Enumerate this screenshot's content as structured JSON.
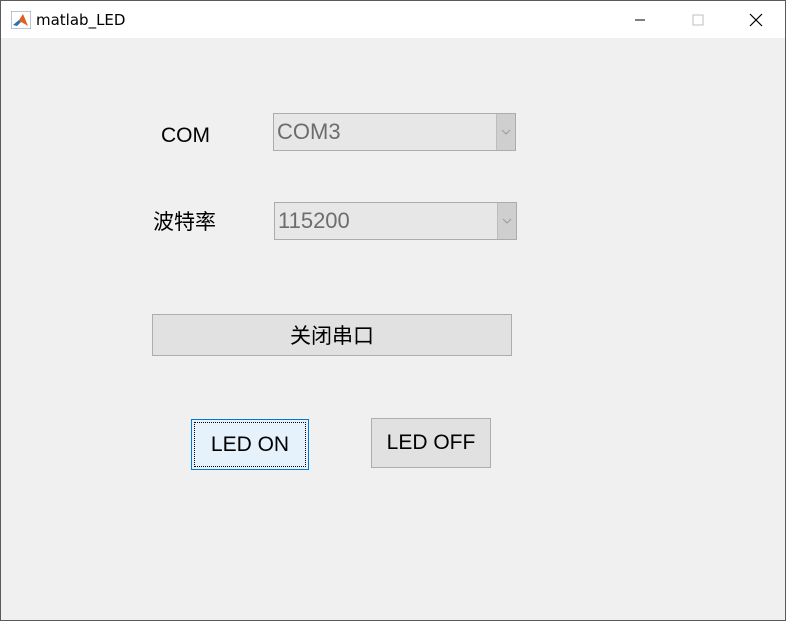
{
  "window": {
    "title": "matlab_LED",
    "controls": {
      "minimize": "minimize",
      "maximize": "maximize",
      "close": "close"
    }
  },
  "form": {
    "com_label": "COM",
    "com_value": "COM3",
    "baud_label": "波特率",
    "baud_value": "115200",
    "close_port_button": "关闭串口",
    "led_on_button": "LED ON",
    "led_off_button": "LED OFF"
  },
  "icons": {
    "app": "matlab-logo-icon",
    "dropdown": "chevron-down-icon"
  },
  "colors": {
    "panel_bg": "#f0f0f0",
    "focus_border": "#0078d7",
    "focus_fill": "#e5f1fb",
    "disabled_text": "#6d6d6d"
  }
}
